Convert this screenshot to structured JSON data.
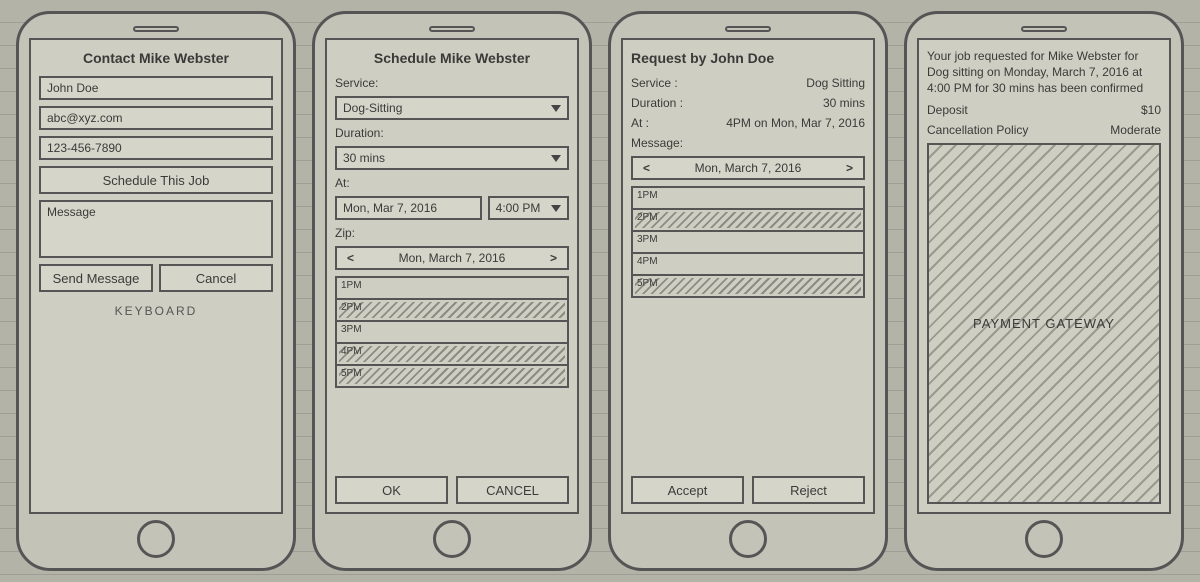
{
  "screen1": {
    "title": "Contact Mike Webster",
    "name": "John Doe",
    "email": "abc@xyz.com",
    "phone": "123-456-7890",
    "schedule_btn": "Schedule This Job",
    "message_placeholder": "Message",
    "send_btn": "Send Message",
    "cancel_btn": "Cancel",
    "keyboard_note": "KEYBOARD"
  },
  "screen2": {
    "title": "Schedule Mike Webster",
    "labels": {
      "service": "Service:",
      "duration": "Duration:",
      "at": "At:",
      "zip": "Zip:"
    },
    "service": "Dog-Sitting",
    "duration": "30 mins",
    "date": "Mon, Mar 7, 2016",
    "time": "4:00 PM",
    "nav_date": "Mon, March 7, 2016",
    "slots": [
      {
        "label": "1PM",
        "busy": false
      },
      {
        "label": "2PM",
        "busy": true
      },
      {
        "label": "3PM",
        "busy": false
      },
      {
        "label": "4PM",
        "busy": true
      },
      {
        "label": "5PM",
        "busy": true
      }
    ],
    "ok_btn": "OK",
    "cancel_btn": "CANCEL"
  },
  "screen3": {
    "title": "Request by John Doe",
    "labels": {
      "service": "Service :",
      "duration": "Duration :",
      "at": "At :",
      "message": "Message:"
    },
    "service": "Dog Sitting",
    "duration": "30 mins",
    "at": "4PM on Mon, Mar 7, 2016",
    "nav_date": "Mon, March 7, 2016",
    "slots": [
      {
        "label": "1PM",
        "busy": false
      },
      {
        "label": "2PM",
        "busy": true
      },
      {
        "label": "3PM",
        "busy": false
      },
      {
        "label": "4PM",
        "busy": false
      },
      {
        "label": "5PM",
        "busy": true
      }
    ],
    "accept_btn": "Accept",
    "reject_btn": "Reject"
  },
  "screen4": {
    "confirmation": "Your job requested for Mike Webster for Dog sitting on Monday, March 7, 2016 at 4:00 PM for 30 mins has been confirmed",
    "deposit_label": "Deposit",
    "deposit_value": "$10",
    "policy_label": "Cancellation Policy",
    "policy_value": "Moderate",
    "gateway": "PAYMENT GATEWAY"
  }
}
